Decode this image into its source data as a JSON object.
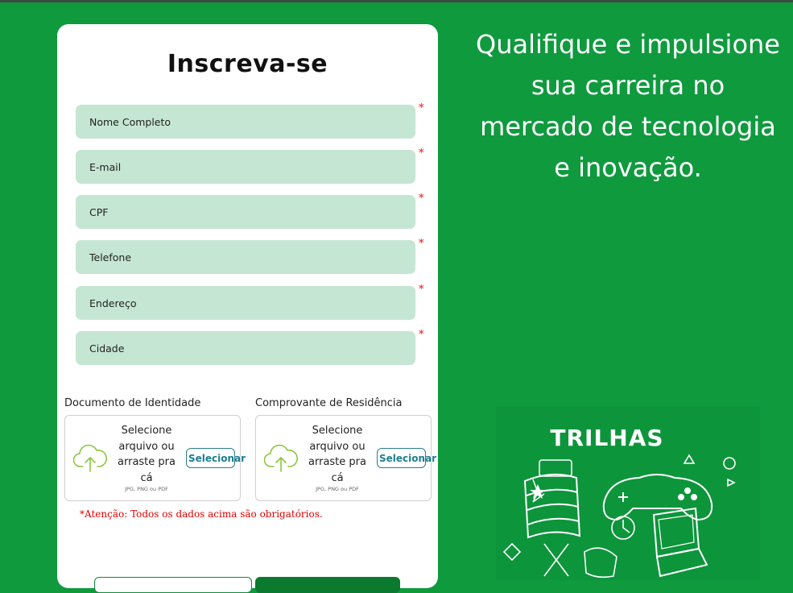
{
  "form": {
    "title": "Inscreva-se",
    "required_mark": "*",
    "fields": [
      {
        "placeholder": "Nome Completo"
      },
      {
        "placeholder": "E-mail"
      },
      {
        "placeholder": "CPF"
      },
      {
        "placeholder": "Telefone"
      },
      {
        "placeholder": "Endereço"
      },
      {
        "placeholder": "Cidade"
      }
    ],
    "uploads": [
      {
        "label": "Documento de Identidade",
        "prompt": "Selecione arquivo ou arraste pra cá",
        "hint": "JPG, PNG ou PDF",
        "button": "Selecionar"
      },
      {
        "label": "Comprovante de Residência",
        "prompt": "Selecione arquivo ou arraste pra cá",
        "hint": "JPG, PNG ou PDF",
        "button": "Selecionar"
      }
    ],
    "warning": "*Atenção: Todos os dados acima são obrigatórios."
  },
  "hero": {
    "headline": "Qualifique e impulsione sua carreira no mercado de tecnologia e inovação.",
    "brand": "TRILHAS"
  },
  "colors": {
    "background": "#0f9a3e",
    "field": "#c5e6d3",
    "accent_button": "#1d7f8f",
    "required": "#e11111"
  },
  "icons": {
    "upload": "cloud-upload-icon",
    "flag": "piaui-flag-icon",
    "gamepad": "gamepad-icon",
    "laptop": "laptop-icon"
  }
}
